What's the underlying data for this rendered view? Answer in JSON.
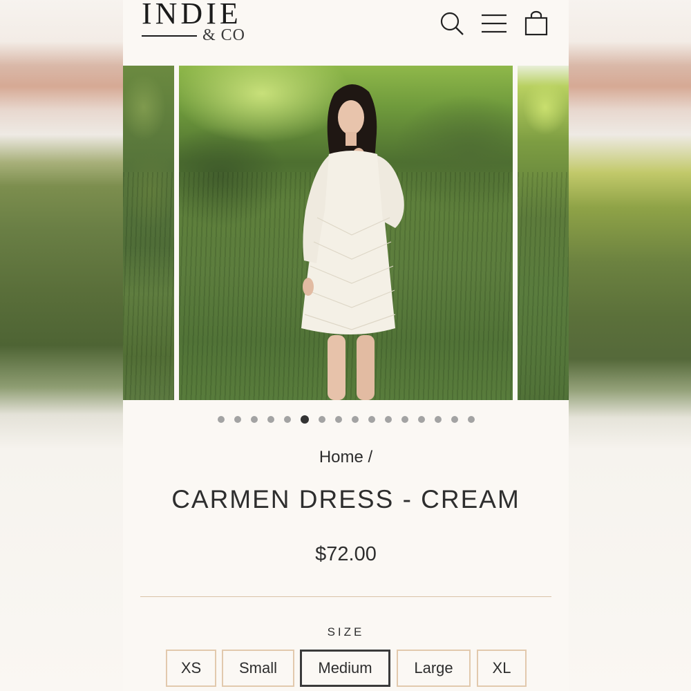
{
  "brand": {
    "name": "INDIE",
    "sub": "& CO"
  },
  "header_icons": [
    "search-icon",
    "menu-icon",
    "cart-icon"
  ],
  "carousel": {
    "slide_count": 16,
    "active_index": 5,
    "zoom_icon": "zoom-icon"
  },
  "breadcrumb": {
    "home": "Home",
    "separator": "/"
  },
  "product": {
    "title": "CARMEN DRESS - CREAM",
    "price": "$72.00"
  },
  "size": {
    "label": "SIZE",
    "options": [
      "XS",
      "Small",
      "Medium",
      "Large",
      "XL"
    ],
    "selected": "Medium"
  },
  "colors": {
    "accent_border": "#e2c9ad",
    "background": "#fbf8f4",
    "text": "#2e2e2e"
  }
}
